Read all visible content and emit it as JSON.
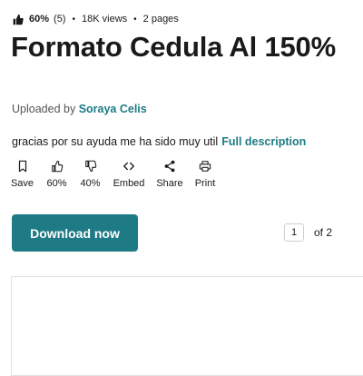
{
  "stats": {
    "rating_icon": "thumbs-up-icon",
    "rating_percent": "60%",
    "rating_count": "(5)",
    "separator": "•",
    "views": "18K views",
    "pages": "2 pages"
  },
  "document": {
    "title": "Formato Cedula Al 150%",
    "uploaded_by_prefix": "Uploaded by",
    "uploader_name": "Soraya Celis",
    "description": "gracias por su ayuda me ha sido muy util",
    "full_description_link": "Full description"
  },
  "actions": [
    {
      "icon": "bookmark-icon",
      "label": "Save"
    },
    {
      "icon": "thumbs-up-icon",
      "label": "60%"
    },
    {
      "icon": "thumbs-down-icon",
      "label": "40%"
    },
    {
      "icon": "embed-icon",
      "label": "Embed"
    },
    {
      "icon": "share-icon",
      "label": "Share"
    },
    {
      "icon": "print-icon",
      "label": "Print"
    }
  ],
  "download": {
    "label": "Download now"
  },
  "pager": {
    "current_page": "1",
    "of_label": "of 2"
  },
  "colors": {
    "accent": "#1e7b85",
    "text": "#1a1a1a",
    "muted": "#555555"
  }
}
